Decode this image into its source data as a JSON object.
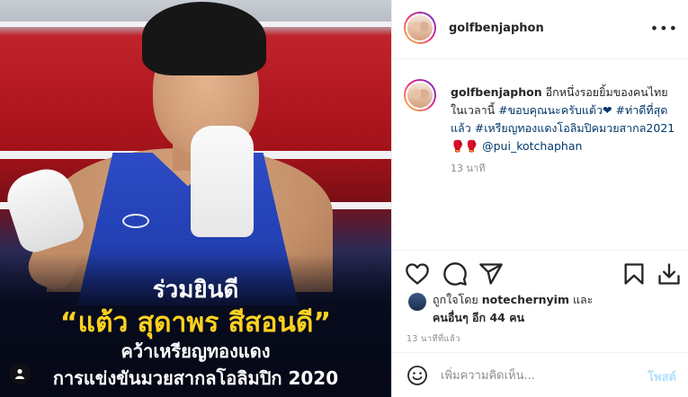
{
  "image": {
    "headline": "ร่วมยินดี",
    "athlete": "“แต้ว สุดาพร สีสอนดี”",
    "line3": "คว้าเหรียญทองแดง",
    "line4": "การแข่งขันมวยสากลโอลิมปิก 2020",
    "headline_color": "#ffffff",
    "athlete_color": "#ffd21f"
  },
  "post": {
    "username": "golfbenjaphon",
    "caption_plain_1": "อีกหนึ่งรอยยิ้มของคนไทยในเวลานี้",
    "caption_tag_1": "#ขอบคุณนะครับแต้ว",
    "caption_boxes": "",
    "caption_heart": "❤",
    "caption_tag_2": "#ท่าดีที่สุดแล้ว",
    "caption_tag_3": "#เหรียญทองแดงโอลิมปิคมวยสากล2021",
    "caption_emoji": "🥊🥊",
    "caption_mention": "@pui_kotchaphan",
    "comment_time": "13 นาที",
    "liked_by_prefix": "ถูกใจโดย",
    "liked_by_user": "notechernyim",
    "liked_by_and": "และ",
    "liked_by_others": "คนอื่นๆ อีก 44 คน",
    "post_time": "13 นาทีที่แล้ว",
    "link_color": "#00376b"
  },
  "comment_box": {
    "placeholder": "เพิ่มความคิดเห็น...",
    "post_label": "โพสต์",
    "post_color": "#b2dffc"
  },
  "icons": {
    "more": "more-options-icon",
    "like": "heart-icon",
    "comment": "comment-icon",
    "share": "paper-plane-icon",
    "save": "bookmark-icon",
    "download": "download-icon",
    "emoji": "smiley-icon",
    "tag": "user-tag-icon"
  }
}
